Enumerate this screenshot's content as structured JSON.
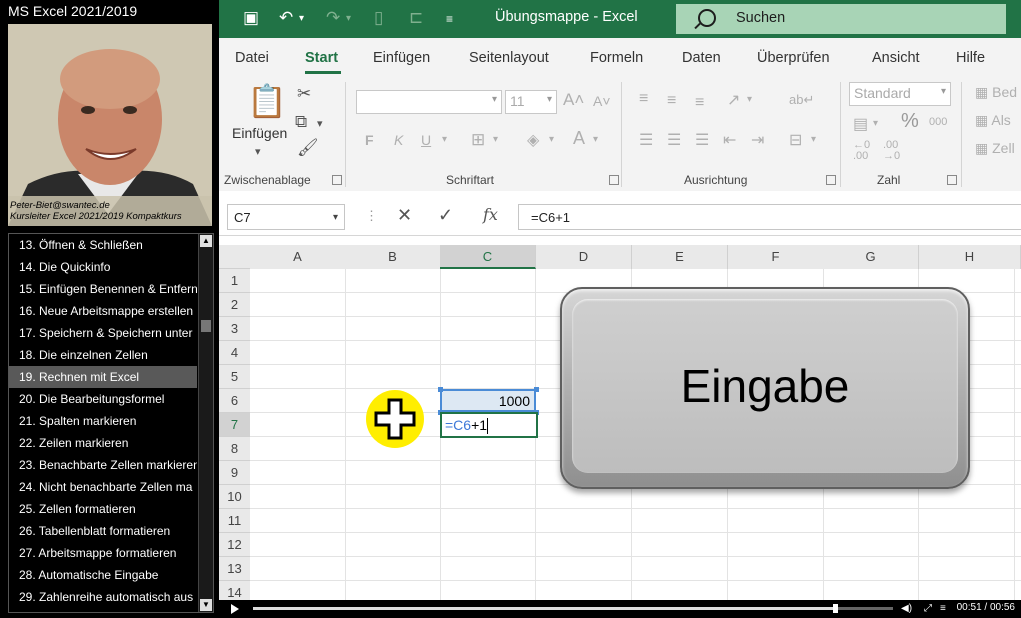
{
  "sidebar": {
    "course_title": "MS Excel 2021/2019",
    "caption_line1": "Peter-Biet@swantec.de",
    "caption_line2": "Kursleiter Excel 2021/2019 Kompaktkurs",
    "lessons": [
      "13. Öffnen & Schließen",
      "14. Die Quickinfo",
      "15. Einfügen Benennen & Entfern",
      "16. Neue Arbeitsmappe erstellen",
      "17. Speichern & Speichern unter",
      "18. Die einzelnen Zellen",
      "19. Rechnen mit Excel",
      "20. Die Bearbeitungsformel",
      "21. Spalten markieren",
      "22. Zeilen markieren",
      "23. Benachbarte Zellen markieren",
      "24. Nicht benachbarte Zellen ma",
      "25. Zellen formatieren",
      "26. Tabellenblatt formatieren",
      "27. Arbeitsmappe formatieren",
      "28. Automatische Eingabe",
      "29. Zahlenreihe automatisch aus"
    ],
    "active_lesson_index": 6
  },
  "excel": {
    "title": "Übungsmappe - Excel",
    "search_label": "Suchen",
    "menu": [
      "Datei",
      "Start",
      "Einfügen",
      "Seitenlayout",
      "Formeln",
      "Daten",
      "Überprüfen",
      "Ansicht",
      "Hilfe"
    ],
    "active_menu": "Start",
    "ribbon": {
      "paste_label": "Einfügen",
      "group_clipboard": "Zwischenablage",
      "group_font": "Schriftart",
      "group_alignment": "Ausrichtung",
      "group_number": "Zahl",
      "font_size": "11",
      "number_format": "Standard",
      "bold": "F",
      "italic": "K",
      "underline": "U",
      "percent": "%",
      "thousands": "000",
      "styles_1": "Bed",
      "styles_2": "Als",
      "styles_3": "Zell"
    },
    "namebox": "C7",
    "formula": "=C6+1",
    "columns": [
      "A",
      "B",
      "C",
      "D",
      "E",
      "F",
      "G",
      "H"
    ],
    "selected_column": "C",
    "rows": [
      "1",
      "2",
      "3",
      "4",
      "5",
      "6",
      "7",
      "8",
      "9",
      "10",
      "11",
      "12",
      "13",
      "14"
    ],
    "selected_row": "7",
    "cell_c6_value": "1000",
    "cell_c7_ref": "=C6",
    "cell_c7_rest": "+1",
    "key_overlay_label": "Eingabe"
  },
  "player": {
    "time": "00:51 / 00:56",
    "progress": 0.91
  }
}
